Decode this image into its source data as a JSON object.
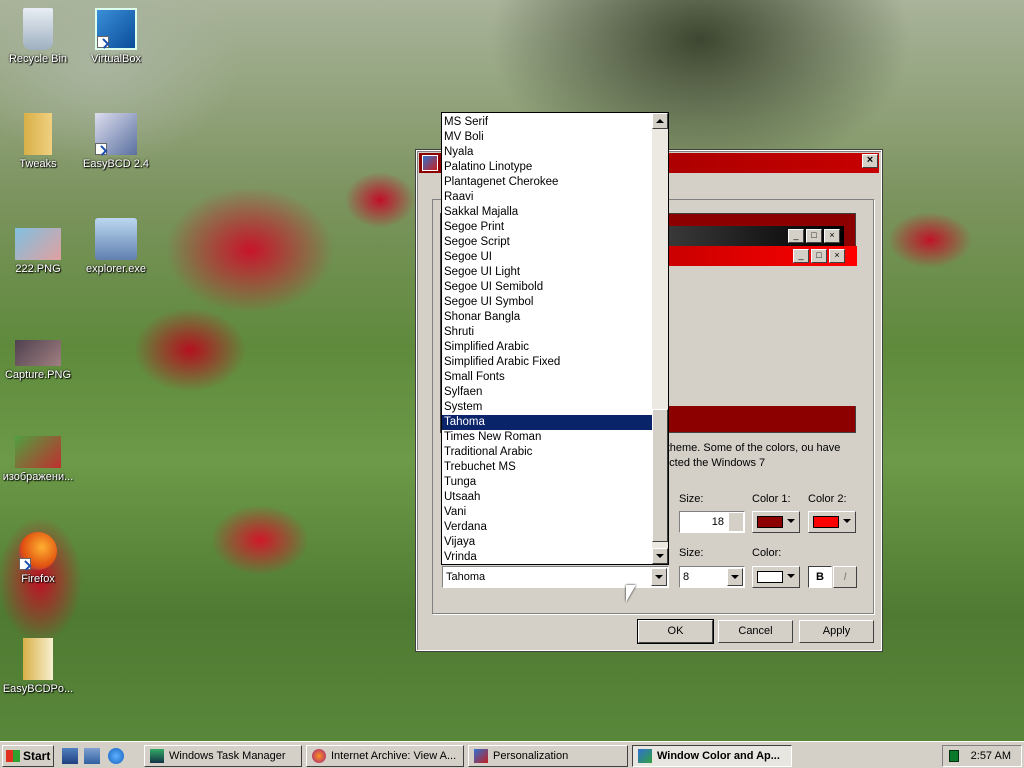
{
  "desktop": {
    "icons": [
      {
        "label": "Recycle Bin"
      },
      {
        "label": "VirtualBox"
      },
      {
        "label": "Tweaks"
      },
      {
        "label": "EasyBCD 2.4"
      },
      {
        "label": "222.PNG"
      },
      {
        "label": "explorer.exe"
      },
      {
        "label": "Capture.PNG"
      },
      {
        "label": "изображени..."
      },
      {
        "label": "Firefox"
      },
      {
        "label": "EasyBCDPo..."
      }
    ]
  },
  "dialog": {
    "close_label": "×",
    "description": "s 7 theme.  Some of the colors, ou have selected the Windows 7",
    "size_label_1": "Size:",
    "size_value_1": "18",
    "color1_label": "Color 1:",
    "color2_label": "Color 2:",
    "size_label_2": "Size:",
    "size_value_2": "8",
    "color_label": "Color:",
    "font_value": "Tahoma",
    "bold_label": "B",
    "italic_label": "I",
    "ok_label": "OK",
    "cancel_label": "Cancel",
    "apply_label": "Apply",
    "colors": {
      "color1": "#8c0000",
      "color2": "#ff0000",
      "font_color": "#ffffff"
    }
  },
  "font_list": {
    "items": [
      "MS Serif",
      "MV Boli",
      "Nyala",
      "Palatino Linotype",
      "Plantagenet Cherokee",
      "Raavi",
      "Sakkal Majalla",
      "Segoe Print",
      "Segoe Script",
      "Segoe UI",
      "Segoe UI Light",
      "Segoe UI Semibold",
      "Segoe UI Symbol",
      "Shonar Bangla",
      "Shruti",
      "Simplified Arabic",
      "Simplified Arabic Fixed",
      "Small Fonts",
      "Sylfaen",
      "System",
      "Tahoma",
      "Times New Roman",
      "Traditional Arabic",
      "Trebuchet MS",
      "Tunga",
      "Utsaah",
      "Vani",
      "Verdana",
      "Vijaya",
      "Vrinda"
    ],
    "selected": "Tahoma"
  },
  "taskbar": {
    "start_label": "Start",
    "tasks": [
      {
        "label": "Windows Task Manager"
      },
      {
        "label": "Internet Archive: View A..."
      },
      {
        "label": "Personalization"
      },
      {
        "label": "Window Color and Ap..."
      }
    ],
    "clock": "2:57 AM"
  }
}
